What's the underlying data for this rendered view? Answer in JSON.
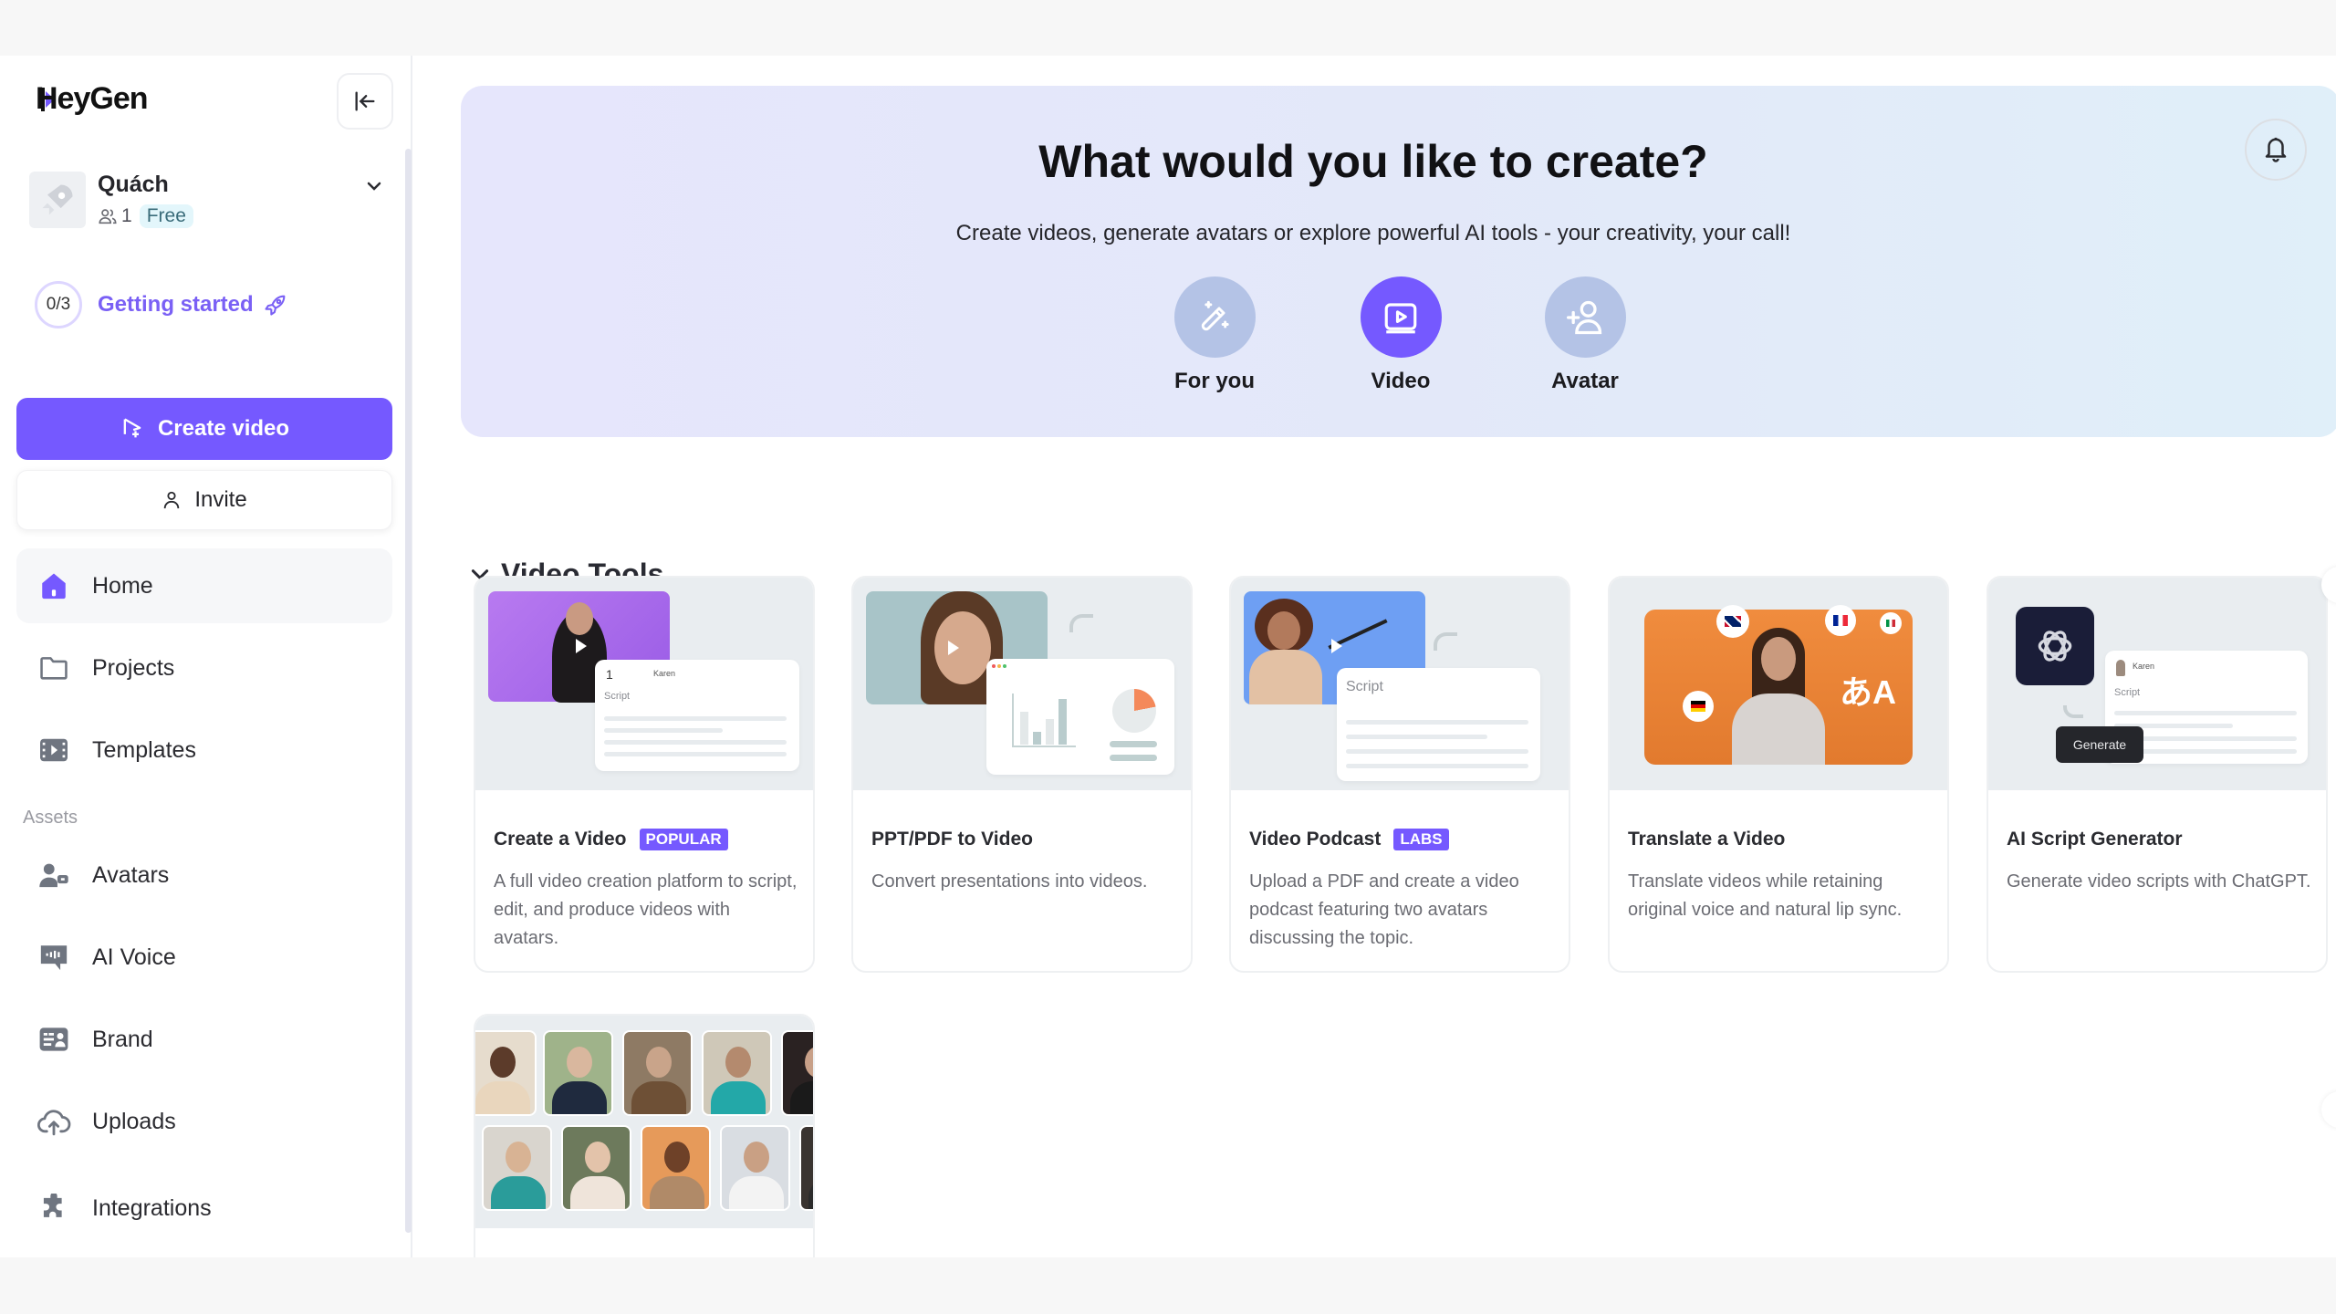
{
  "brand": {
    "name": "HeyGen",
    "accent": "#7559ff"
  },
  "sidebar": {
    "collapse_icon": "collapse-left-icon",
    "account": {
      "name": "Quách",
      "member_count": "1",
      "plan": "Free"
    },
    "getting_started": {
      "progress": "0/3",
      "completed": 0,
      "total": 3,
      "label": "Getting started"
    },
    "create_video_label": "Create video",
    "invite_label": "Invite",
    "nav": [
      {
        "label": "Home",
        "icon": "home-icon",
        "active": true
      },
      {
        "label": "Projects",
        "icon": "folder-icon"
      },
      {
        "label": "Templates",
        "icon": "film-icon"
      }
    ],
    "assets_heading": "Assets",
    "assets": [
      {
        "label": "Avatars",
        "icon": "avatar-icon"
      },
      {
        "label": "AI Voice",
        "icon": "voice-icon"
      },
      {
        "label": "Brand",
        "icon": "brand-icon"
      },
      {
        "label": "Uploads",
        "icon": "cloud-upload-icon"
      },
      {
        "label": "Integrations",
        "icon": "puzzle-icon"
      }
    ]
  },
  "hero": {
    "title": "What would you like to create?",
    "subtitle": "Create videos, generate avatars or explore powerful AI tools - your creativity, your call!",
    "options": [
      {
        "label": "For you",
        "icon": "magic-wand-icon",
        "active": false
      },
      {
        "label": "Video",
        "icon": "video-play-icon",
        "active": true
      },
      {
        "label": "Avatar",
        "icon": "add-user-icon",
        "active": false
      }
    ]
  },
  "section": {
    "title": "Video Tools",
    "cards": [
      {
        "title": "Create a Video",
        "tag": "POPULAR",
        "desc": "A full video creation platform to script, edit, and produce videos with avatars.",
        "thumb_script_label": "Script",
        "thumb_number": "1",
        "thumb_name": "Karen"
      },
      {
        "title": "PPT/PDF to Video",
        "tag": "",
        "desc": "Convert presentations into videos."
      },
      {
        "title": "Video Podcast",
        "tag": "LABS",
        "desc": "Upload a PDF and create a video podcast featuring two avatars discussing the topic.",
        "thumb_script_label": "Script"
      },
      {
        "title": "Translate a Video",
        "tag": "",
        "desc": "Translate videos while retaining original voice and natural lip sync.",
        "thumb_glyph": "あA"
      },
      {
        "title": "AI Script Generator",
        "tag": "",
        "desc": "Generate video scripts with ChatGPT.",
        "thumb_script_label": "Script",
        "thumb_name": "Karen",
        "thumb_button": "Generate"
      }
    ]
  }
}
